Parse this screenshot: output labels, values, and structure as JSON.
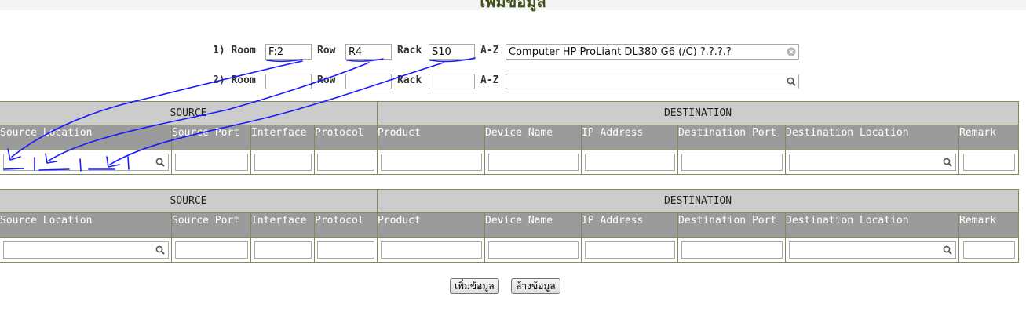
{
  "page": {
    "title": "เพิ่มข้อมูล"
  },
  "filter_rows": [
    {
      "label_index": "1) Room",
      "room": "F:2",
      "row_label": "Row",
      "row": "R4",
      "rack_label": "Rack",
      "rack": "S10",
      "az_label": "A-Z",
      "az_value": "Computer HP ProLiant DL380 G6 (/C) ?.?.?.?"
    },
    {
      "label_index": "2) Room",
      "room": "",
      "row_label": "Row",
      "row": "",
      "rack_label": "Rack",
      "rack": "",
      "az_label": "A-Z",
      "az_value": ""
    }
  ],
  "tables": [
    {
      "group_source": "SOURCE",
      "group_destination": "DESTINATION",
      "columns": [
        "Source Location",
        "Source Port",
        "Interface",
        "Protocol",
        "Product",
        "Device Name",
        "IP Address",
        "Destination Port",
        "Destination Location",
        "Remark"
      ]
    },
    {
      "group_source": "SOURCE",
      "group_destination": "DESTINATION",
      "columns": [
        "Source Location",
        "Source Port",
        "Interface",
        "Protocol",
        "Product",
        "Device Name",
        "IP Address",
        "Destination Port",
        "Destination Location",
        "Remark"
      ]
    }
  ],
  "buttons": {
    "add": "เพิ่มข้อมูล",
    "clear": "ล้างข้อมูล"
  },
  "icons": {
    "search": "search-icon",
    "clear": "clear-icon"
  },
  "colors": {
    "header_light": "#cccccc",
    "header_dark": "#9b9b9b",
    "border": "#7f8a5e",
    "annotation_ink": "#1a1aff"
  }
}
